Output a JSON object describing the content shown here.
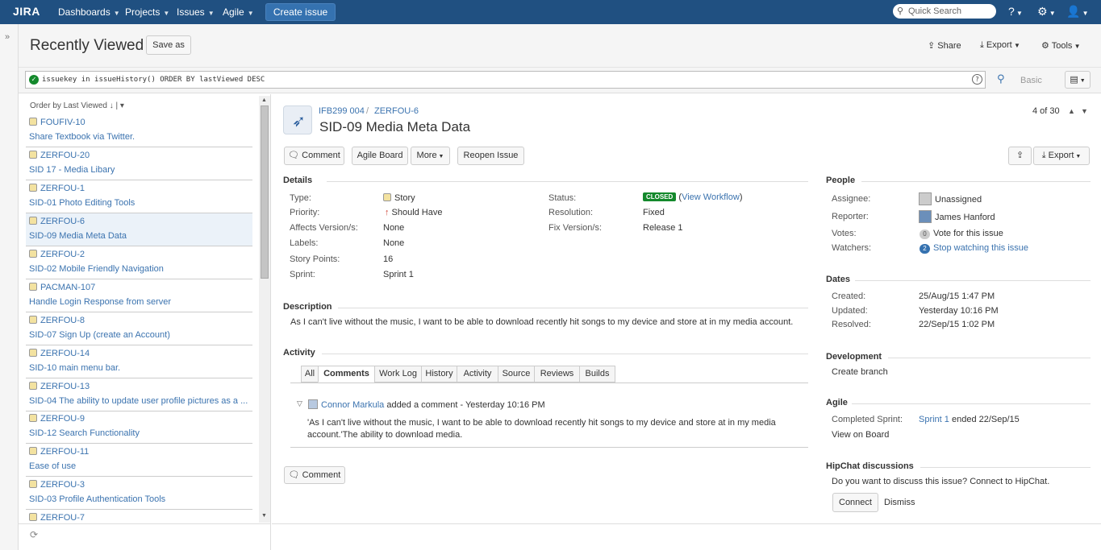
{
  "nav": {
    "logo": "JIRA",
    "items": [
      "Dashboards",
      "Projects",
      "Issues",
      "Agile"
    ],
    "create_label": "Create issue",
    "search_placeholder": "Quick Search"
  },
  "header": {
    "title": "Recently Viewed",
    "save_as": "Save as",
    "share": "Share",
    "export": "Export",
    "tools": "Tools"
  },
  "search": {
    "jql": "issuekey in issueHistory() ORDER BY lastViewed DESC",
    "basic": "Basic"
  },
  "list": {
    "order_label": "Order by Last Viewed",
    "items": [
      {
        "key": "FOUFIV-10",
        "summary": "Share Textbook via Twitter."
      },
      {
        "key": "ZERFOU-20",
        "summary": "SID 17 - Media Libary"
      },
      {
        "key": "ZERFOU-1",
        "summary": "SID-01 Photo Editing Tools"
      },
      {
        "key": "ZERFOU-6",
        "summary": "SID-09 Media Meta Data"
      },
      {
        "key": "ZERFOU-2",
        "summary": "SID-02 Mobile Friendly Navigation"
      },
      {
        "key": "PACMAN-107",
        "summary": "Handle Login Response from server"
      },
      {
        "key": "ZERFOU-8",
        "summary": "SID-07 Sign Up (create an Account)"
      },
      {
        "key": "ZERFOU-14",
        "summary": "SID-10 main menu bar."
      },
      {
        "key": "ZERFOU-13",
        "summary": "SID-04 The ability to update user profile pictures as a ..."
      },
      {
        "key": "ZERFOU-9",
        "summary": "SID-12 Search Functionality"
      },
      {
        "key": "ZERFOU-11",
        "summary": "Ease of use"
      },
      {
        "key": "ZERFOU-3",
        "summary": "SID-03 Profile Authentication Tools"
      },
      {
        "key": "ZERFOU-7",
        "summary": ""
      }
    ]
  },
  "issue": {
    "project": "IFB299 004",
    "key": "ZERFOU-6",
    "summary": "SID-09 Media Meta Data",
    "pager": "4 of 30",
    "actions": {
      "comment": "Comment",
      "agile_board": "Agile Board",
      "more": "More",
      "reopen": "Reopen Issue",
      "export": "Export"
    },
    "details_title": "Details",
    "fields": {
      "type_label": "Type:",
      "type": "Story",
      "priority_label": "Priority:",
      "priority": "Should Have",
      "affects_label": "Affects Version/s:",
      "affects": "None",
      "labels_label": "Labels:",
      "labels": "None",
      "points_label": "Story Points:",
      "points": "16",
      "sprint_label": "Sprint:",
      "sprint": "Sprint 1",
      "status_label": "Status:",
      "status": "CLOSED",
      "view_workflow": "View Workflow",
      "resolution_label": "Resolution:",
      "resolution": "Fixed",
      "fix_label": "Fix Version/s:",
      "fix": "Release 1"
    },
    "description_title": "Description",
    "description": "As I can't live without the music, I want to be able to download recently hit songs to my device and store at in my media account.",
    "activity_title": "Activity",
    "tabs": [
      "All",
      "Comments",
      "Work Log",
      "History",
      "Activity",
      "Source",
      "Reviews",
      "Builds"
    ],
    "comment": {
      "author": "Connor Markula",
      "meta": "added a comment - Yesterday 10:16 PM",
      "line1": "'As I can't live without the music, I want to be able to download recently hit songs to my device and store at in my media",
      "line2": "account.'The ability to download media."
    },
    "comment_button": "Comment"
  },
  "people": {
    "title": "People",
    "assignee_label": "Assignee:",
    "assignee": "Unassigned",
    "reporter_label": "Reporter:",
    "reporter": "James Hanford",
    "votes_label": "Votes:",
    "votes_count": "0",
    "votes": "Vote for this issue",
    "watchers_label": "Watchers:",
    "watchers_count": "2",
    "watchers": "Stop watching this issue"
  },
  "dates": {
    "title": "Dates",
    "created_label": "Created:",
    "created": "25/Aug/15 1:47 PM",
    "updated_label": "Updated:",
    "updated": "Yesterday 10:16 PM",
    "resolved_label": "Resolved:",
    "resolved": "22/Sep/15 1:02 PM"
  },
  "development": {
    "title": "Development",
    "create_branch": "Create branch"
  },
  "agile": {
    "title": "Agile",
    "completed_label": "Completed Sprint:",
    "sprint": "Sprint 1",
    "ended": "ended 22/Sep/15",
    "view_board": "View on Board"
  },
  "hipchat": {
    "title": "HipChat discussions",
    "text": "Do you want to discuss this issue? Connect to HipChat.",
    "connect": "Connect",
    "dismiss": "Dismiss"
  }
}
